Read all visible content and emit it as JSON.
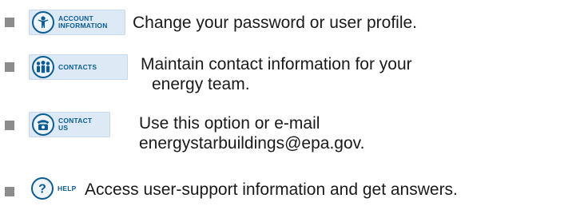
{
  "items": [
    {
      "button_label": "ACCOUNT\nINFORMATION",
      "icon": "account-info-icon",
      "description_lines": [
        "Change your password or user profile."
      ]
    },
    {
      "button_label": "CONTACTS",
      "icon": "contacts-icon",
      "description_lines": [
        "Maintain contact information for your",
        "energy team."
      ]
    },
    {
      "button_label": "CONTACT\nUS",
      "icon": "contact-us-icon",
      "description_lines": [
        "Use this option or e-mail",
        "energystarbuildings@epa.gov."
      ]
    },
    {
      "button_label": "HELP",
      "icon": "help-icon",
      "description_lines": [
        "Access user-support information and get answers."
      ]
    }
  ],
  "colors": {
    "accent": "#0b5b95",
    "button_bg": "#ddeaf6",
    "bullet": "#8c8c8c",
    "text": "#1a1a1a"
  }
}
